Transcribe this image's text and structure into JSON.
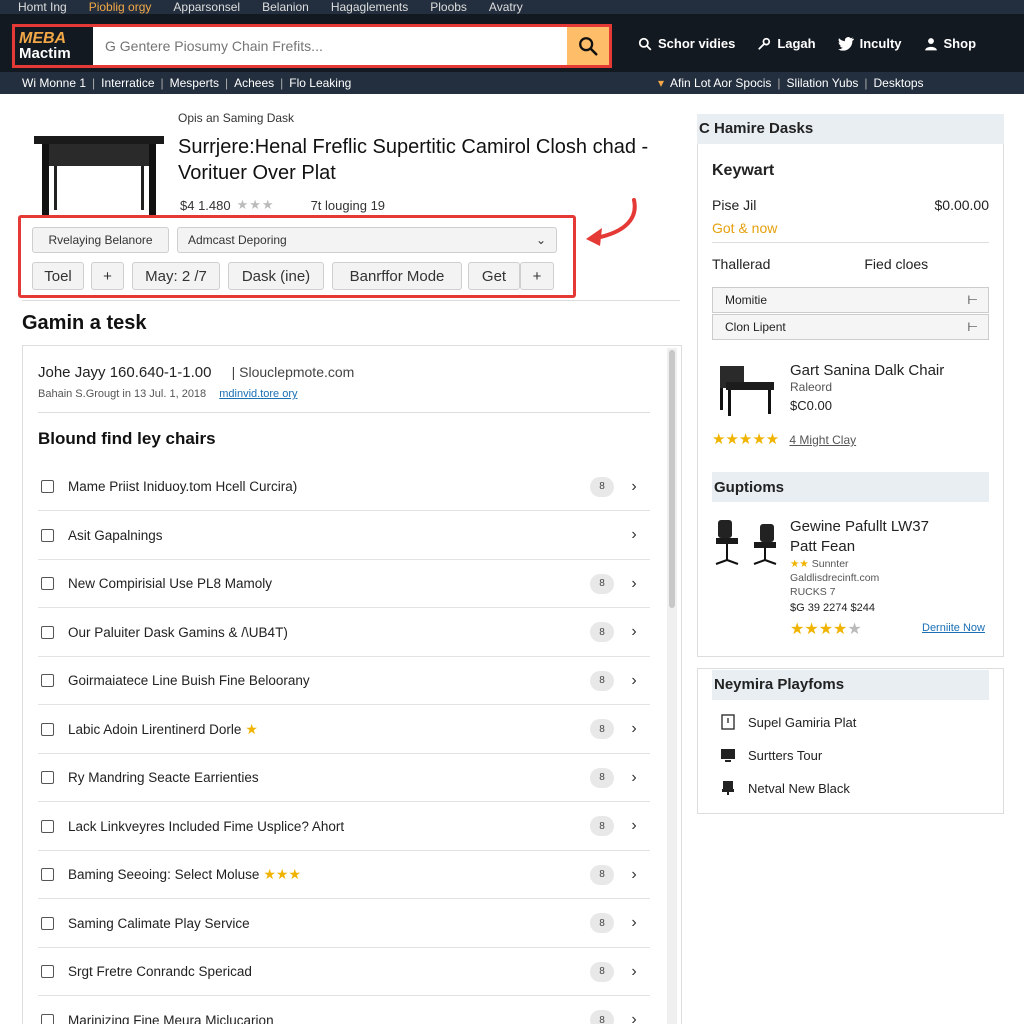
{
  "top_strip": [
    "Homt Ing",
    "Pioblig orgy",
    "Apparsonsel",
    "Belanion",
    "Hagaglements",
    "Ploobs",
    "Avatry"
  ],
  "header": {
    "logo_line1": "MEBA",
    "logo_line2": "Mactim",
    "search_placeholder": "G Gentere Piosumy Chain Frefits...",
    "links": [
      {
        "label": "Schor vidies",
        "icon": "search-icon"
      },
      {
        "label": "Lagah",
        "icon": "wrench-icon"
      },
      {
        "label": "Inculty",
        "icon": "twitter-icon"
      },
      {
        "label": "Shop",
        "icon": "user-icon"
      }
    ]
  },
  "subnav": {
    "left": [
      "Wi Monne 1",
      "Interratice",
      "Mesperts",
      "Achees",
      "Flo Leaking"
    ],
    "right": [
      "Afin Lot Aor Spocis",
      "Slilation Yubs",
      "Desktops"
    ]
  },
  "product": {
    "crumb": "Opis an Saming Dask",
    "title": "Surrjere:Henal Freflic Supertitic Camirol Closh chad - Vorituer Over Plat",
    "rating_text": "$4 1.480",
    "rating_meta": "7t louging 19",
    "buttons_row1": [
      "Rvelaying Belanore",
      "Admcast Deporing"
    ],
    "buttons_row2": [
      "Toel",
      "+",
      "May: 2 /7",
      "Dask (ine)",
      "Banrffor Mode",
      "Get",
      "+"
    ]
  },
  "section_title": "Gamin a tesk",
  "contact": {
    "line": "Johe Jayy 160.640-1-1.00",
    "web": "| Slouclepmote.com",
    "sub": "Bahain S.Grougt in 13 Jul. 1, 2018",
    "link": "mdinvid.tore ory"
  },
  "list_heading": "Blound find ley chairs",
  "list_items": [
    {
      "label": "Mame Priist Iniduoy.tom Hcell Curcira)",
      "badge": "8",
      "star": ""
    },
    {
      "label": "Asit Gapalnings",
      "badge": "",
      "star": ""
    },
    {
      "label": "New Compirisial Use PL8 Mamoly",
      "badge": "8",
      "star": ""
    },
    {
      "label": "Our Paluiter Dask Gamins & /\\UB4T)",
      "badge": "8",
      "star": ""
    },
    {
      "label": "Goirmaiatece Line Buish Fine Beloorany",
      "badge": "8",
      "star": ""
    },
    {
      "label": "Labic Adoin Lirentinerd Dorle",
      "badge": "8",
      "star": "★"
    },
    {
      "label": "Ry Mandring Seacte Earrienties",
      "badge": "8",
      "star": ""
    },
    {
      "label": "Lack Linkveyres Included Fime Usplice? Ahort",
      "badge": "8",
      "star": ""
    },
    {
      "label": "Baming Seeoing: Select Moluse",
      "badge": "8",
      "star": "★★★"
    },
    {
      "label": "Saming Calimate Play Service",
      "badge": "8",
      "star": ""
    },
    {
      "label": "Srgt Fretre Conrandc Spericad",
      "badge": "8",
      "star": ""
    },
    {
      "label": "Marinizing Fine Meura Miclucarion",
      "badge": "8",
      "star": ""
    }
  ],
  "sidebar": {
    "head": "C Hamire Dasks",
    "keyword_title": "Keywart",
    "price_label": "Pise Jil",
    "price_value": "$0.00.00",
    "cta": "Got & now",
    "col1": "Thallerad",
    "col2": "Fied cloes",
    "dropdowns": [
      "Momitie",
      "Clon Lipent"
    ],
    "item": {
      "title": "Gart Sanina Dalk Chair",
      "sub": "Raleord",
      "price": "$C0.00",
      "stars": "★★★★★",
      "stars_label": "4 Might Clay"
    },
    "options_head": "Guptioms",
    "option": {
      "title_l1": "Gewine Pafullt LW37",
      "title_l2": "Patt Fean",
      "meta1": "Sunnter",
      "meta2": "Galdlisdrecinft.com",
      "meta3": "RUCKS 7",
      "price": "$G 39 2274 $244",
      "stars_full": "★★★★",
      "stars_empty": "★",
      "link": "Derniite Now"
    },
    "play_head": "Neymira Playfoms",
    "play_items": [
      "Supel Gamiria Plat",
      "Surtters Tour",
      "Netval New Black"
    ]
  },
  "colors": {
    "accent": "#febd69",
    "annotation": "#e53935",
    "header": "#131921",
    "subnav": "#232f3e",
    "link": "#1a6fb5"
  }
}
